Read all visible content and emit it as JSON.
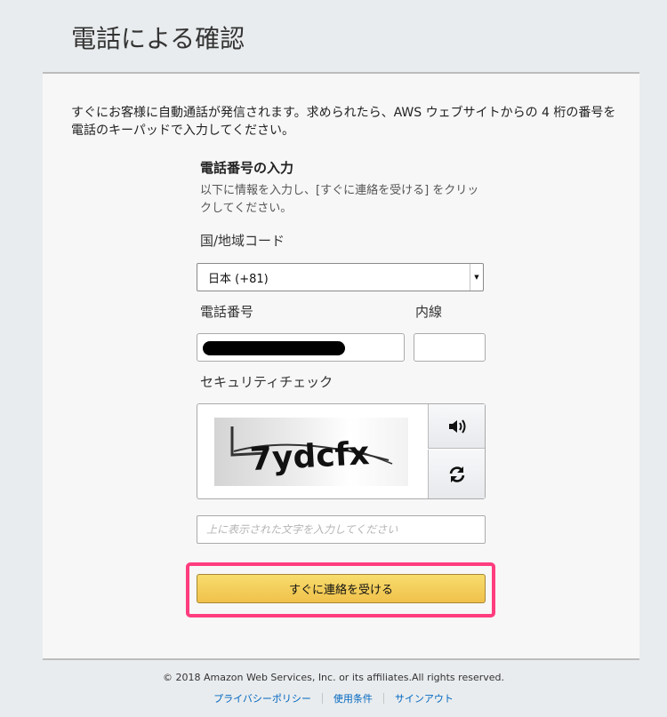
{
  "page": {
    "title": "電話による確認",
    "intro": "すぐにお客様に自動通話が発信されます。求められたら、AWS ウェブサイトからの 4 桁の番号を電話のキーパッドで入力してください。"
  },
  "form": {
    "heading": "電話番号の入力",
    "description": "以下に情報を入力し、[すぐに連絡を受ける] をクリックしてください。",
    "country_label": "国/地域コード",
    "country_value": "日本 (+81)",
    "phone_label": "電話番号",
    "extension_label": "内線",
    "security_label": "セキュリティチェック",
    "captcha_text": "7ydcfx",
    "captcha_placeholder": "上に表示された文字を入力してください",
    "submit_label": "すぐに連絡を受ける"
  },
  "footer": {
    "copyright": "© 2018 Amazon Web Services, Inc. or its affiliates.All rights reserved.",
    "links": [
      "プライバシーポリシー",
      "使用条件",
      "サインアウト"
    ]
  },
  "colors": {
    "button": "#f0c14b",
    "highlight": "#ff3d7f",
    "link": "#0066c0"
  }
}
